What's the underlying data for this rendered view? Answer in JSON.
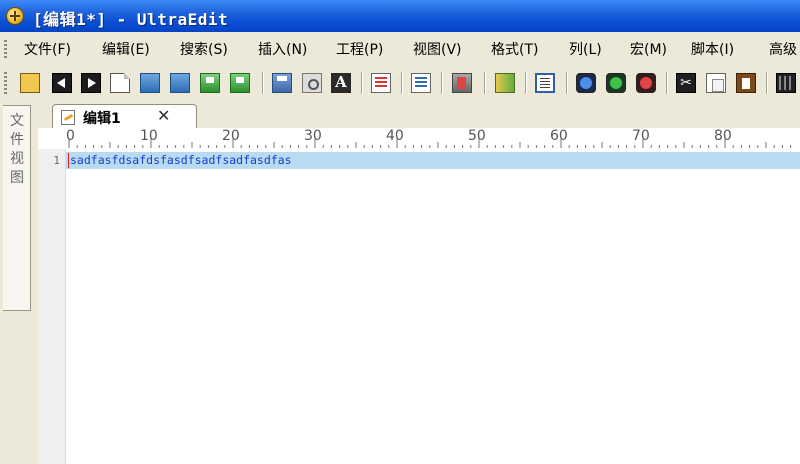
{
  "window": {
    "title": "[编辑1*] - UltraEdit",
    "app_icon": "ultraedit-app-icon"
  },
  "menu": {
    "items": [
      {
        "label": "文件(F)",
        "name": "menu-file"
      },
      {
        "label": "编辑(E)",
        "name": "menu-edit"
      },
      {
        "label": "搜索(S)",
        "name": "menu-search"
      },
      {
        "label": "插入(N)",
        "name": "menu-insert"
      },
      {
        "label": "工程(P)",
        "name": "menu-project"
      },
      {
        "label": "视图(V)",
        "name": "menu-view"
      },
      {
        "label": "格式(T)",
        "name": "menu-format"
      },
      {
        "label": "列(L)",
        "name": "menu-column"
      },
      {
        "label": "宏(M)",
        "name": "menu-macro"
      },
      {
        "label": "脚本(I)",
        "name": "menu-script"
      },
      {
        "label": "高级",
        "name": "menu-advanced"
      }
    ]
  },
  "toolbar": {
    "icons": [
      "new-file-icon",
      "back-arrow-icon",
      "forward-arrow-icon",
      "new-document-icon",
      "open-folder-icon",
      "open-folder-alt-icon",
      "save-icon",
      "save-all-icon",
      "print-icon",
      "print-preview-icon",
      "font-icon",
      "word-count-icon",
      "line-list-icon",
      "tag-list-icon",
      "column-mode-icon",
      "word-wrap-icon",
      "blue-circle-icon",
      "green-circle-icon",
      "red-circle-icon",
      "cut-icon",
      "copy-icon",
      "paste-icon",
      "film-icon"
    ]
  },
  "sidebar": {
    "tab_label": "文件视图"
  },
  "tabs": [
    {
      "label": "编辑1",
      "close": "✕",
      "active": true
    }
  ],
  "ruler": {
    "labels": [
      "0",
      "10",
      "20",
      "30",
      "40",
      "50",
      "60",
      "70",
      "80"
    ]
  },
  "editor": {
    "lines": [
      {
        "number": "1",
        "text": "sadfasfdsafdsfasdfsadfsadfasdfas"
      }
    ]
  }
}
